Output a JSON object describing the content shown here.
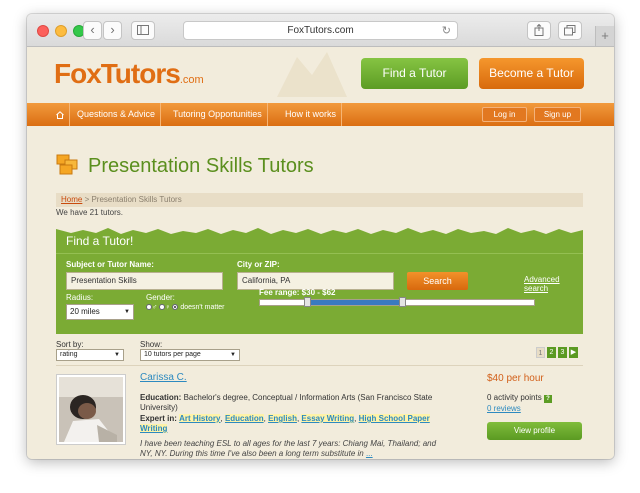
{
  "browser": {
    "url": "FoxTutors.com",
    "back_icon": "chevron-left-icon",
    "forward_icon": "chevron-right-icon"
  },
  "header": {
    "logo_text": "FoxTutors",
    "logo_suffix": ".com",
    "find_tutor_label": "Find a Tutor",
    "become_tutor_label": "Become a Tutor"
  },
  "nav": {
    "items": [
      {
        "label": "Questions & Advice"
      },
      {
        "label": "Tutoring Opportunities"
      },
      {
        "label": "How it works"
      }
    ],
    "login_label": "Log in",
    "signup_label": "Sign up"
  },
  "page": {
    "title": "Presentation Skills Tutors",
    "breadcrumb_home": "Home",
    "breadcrumb_current": " > Presentation Skills Tutors",
    "tutor_count_text": "We have 21 tutors."
  },
  "search_panel": {
    "title": "Find a Tutor!",
    "subject_label": "Subject or Tutor Name:",
    "subject_value": "Presentation Skills",
    "city_label": "City or ZIP:",
    "city_value": "California, PA",
    "search_label": "Search",
    "advanced_label": "Advanced search",
    "radius_label": "Radius:",
    "radius_value": "20 miles",
    "gender_label": "Gender:",
    "gender_option_label": "doesn't matter",
    "fee_label": "Fee range: $30 - $62",
    "fee_min": 30,
    "fee_max": 62,
    "slider_low_fraction": 0.17,
    "slider_high_fraction": 0.52
  },
  "list_controls": {
    "sort_label": "Sort by:",
    "sort_value": "rating",
    "show_label": "Show:",
    "show_value": "10 tutors per page",
    "pages": [
      "1",
      "2",
      "3"
    ],
    "current_page": "1"
  },
  "tutor": {
    "name": "Carissa C.",
    "education_label": "Education:",
    "education_value": "Bachelor's degree, Conceptual / Information Arts (San Francisco State University)",
    "expert_label": "Expert in:",
    "expert_tags": [
      "Art History",
      "Education",
      "English",
      "Essay Writing",
      "High School Paper Writing"
    ],
    "bio": "I have been teaching ESL to all ages for the last 7 years: Chiang Mai, Thailand; and NY, NY. During this time I've also been a long term substitute in",
    "bio_more": "...",
    "price": "$40 per hour",
    "activity_points": "0 activity points",
    "reviews": "0 reviews",
    "view_profile_label": "View profile"
  },
  "colors": {
    "accent_orange": "#e06e14",
    "accent_green": "#5b8f1e",
    "panel_green": "#7bab34",
    "link_blue": "#2d8ac0"
  }
}
